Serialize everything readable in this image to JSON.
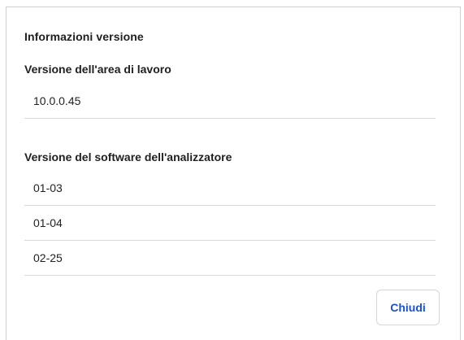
{
  "dialog": {
    "title": "Informazioni versione",
    "workspace": {
      "heading": "Versione dell'area di lavoro",
      "value": "10.0.0.45"
    },
    "analyzer": {
      "heading": "Versione del software dell'analizzatore",
      "versions": [
        "01-03",
        "01-04",
        "02-25"
      ]
    },
    "close_label": "Chiudi"
  },
  "colors": {
    "accent": "#1a4fd6",
    "divider": "#d9d9d9",
    "border": "#cfcfcf"
  }
}
